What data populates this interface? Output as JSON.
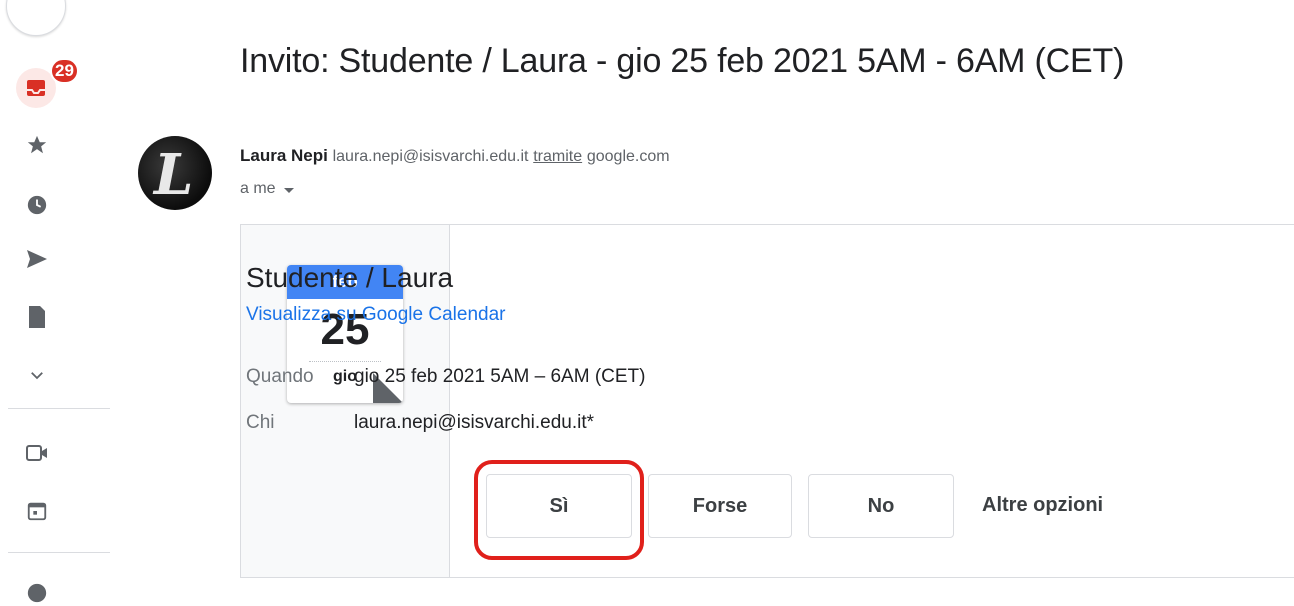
{
  "rail": {
    "unread_count": "29",
    "icons": [
      "inbox-icon",
      "star-icon",
      "clock-icon",
      "send-icon",
      "file-icon",
      "chevron-down-icon",
      "video-icon",
      "calendar-icon",
      "chat-icon"
    ]
  },
  "email": {
    "subject": "Invito: Studente / Laura - gio 25 feb 2021 5AM - 6AM (CET)",
    "sender_name": "Laura Nepi",
    "sender_email": "laura.nepi@isisvarchi.edu.it",
    "via_label": "tramite",
    "via_domain": "google.com",
    "to_label": "a me"
  },
  "calendar_icon": {
    "month": "feb",
    "day": "25",
    "weekday": "gio"
  },
  "event": {
    "title": "Studente / Laura",
    "view_link": "Visualizza su Google Calendar",
    "when_label": "Quando",
    "when_value": "gio 25 feb 2021 5AM – 6AM (CET)",
    "who_label": "Chi",
    "who_value": "laura.nepi@isisvarchi.edu.it*"
  },
  "rsvp": {
    "yes": "Sì",
    "maybe": "Forse",
    "no": "No",
    "more": "Altre opzioni"
  },
  "colors": {
    "badge": "#d93025",
    "link": "#1a73e8",
    "calendar_header": "#4285f4",
    "highlight": "#e0201b"
  }
}
